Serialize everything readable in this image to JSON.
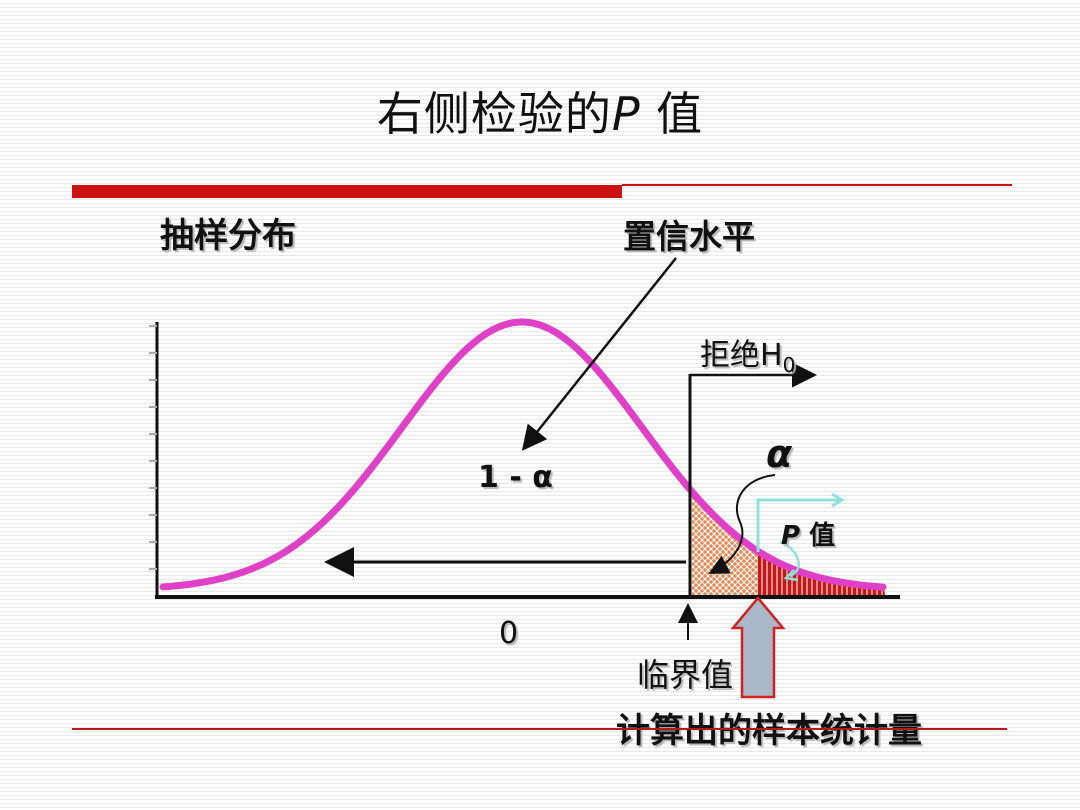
{
  "title": {
    "main": "右侧检验的",
    "italic": "P",
    "suffix": " 值"
  },
  "labels": {
    "sampling_distribution": "抽样分布",
    "confidence_level": "置信水平",
    "one_minus_alpha": "1 - α",
    "reject_h0": "拒绝H",
    "reject_h0_sub": "0",
    "alpha": "α",
    "p_value_italic": "P",
    "p_value_suffix": " 值",
    "zero": "0",
    "critical_value": "临界值",
    "computed_statistic": "计算出的样本统计量"
  },
  "colors": {
    "curve": "#e040c8",
    "accent_red": "#cc1111",
    "alpha_fill": "#e07a40",
    "p_fill": "#c41818",
    "arrow_fill": "#a8b8c8",
    "arrow_stroke": "#d02020",
    "p_bracket": "#8fe0d8"
  }
}
